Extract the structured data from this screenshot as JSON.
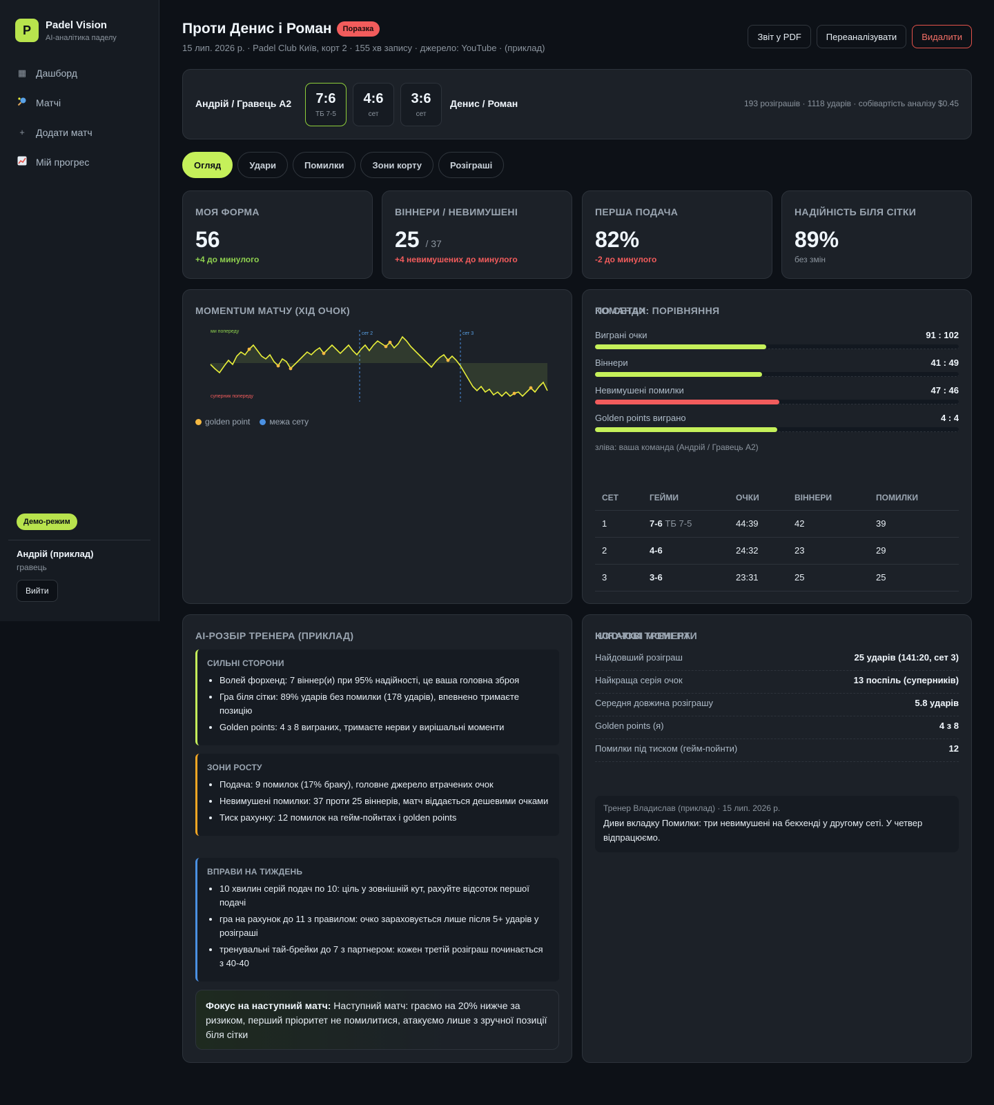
{
  "brand": {
    "name": "Padel Vision",
    "subtitle": "AI-аналітика паделу",
    "logo_letter": "P"
  },
  "nav": [
    {
      "label": "Дашборд",
      "icon": "dashboard-icon"
    },
    {
      "label": "Матчі",
      "icon": "racket-icon"
    },
    {
      "label": "Додати матч",
      "icon": "plus-icon"
    },
    {
      "label": "Мій прогрес",
      "icon": "chart-icon"
    }
  ],
  "sidebar": {
    "demo_badge": "Демо-режим",
    "user_name": "Андрій (приклад)",
    "user_role": "гравець",
    "logout": "Вийти"
  },
  "header": {
    "title": "Проти Денис і Роман",
    "result_badge": "Поразка",
    "subtitle": "15 лип. 2026 р. · Padel Club Київ, корт 2 · 155 хв запису · джерело: YouTube · (приклад)",
    "buttons": {
      "pdf": "Звіт у PDF",
      "reanalyze": "Переаналізувати",
      "delete": "Видалити"
    }
  },
  "score": {
    "team_left": "Андрій / Гравець A2",
    "team_right": "Денис / Роман",
    "sets": [
      {
        "score": "7:6",
        "caption": "ТБ 7-5",
        "won": true
      },
      {
        "score": "4:6",
        "caption": "сет",
        "won": false
      },
      {
        "score": "3:6",
        "caption": "сет",
        "won": false
      }
    ],
    "meta": "193 розіграшів · 1118 ударів · собівартість аналізу $0.45"
  },
  "tabs": [
    "Огляд",
    "Удари",
    "Помилки",
    "Зони корту",
    "Розіграші"
  ],
  "stats": [
    {
      "label": "МОЯ ФОРМА",
      "value": "56",
      "suffix": "",
      "delta": "+4 до минулого",
      "tone": "green"
    },
    {
      "label": "ВІННЕРИ / НЕВИМУШЕНІ",
      "value": "25",
      "suffix": "/ 37",
      "delta": "+4 невимушених до минулого",
      "tone": "red"
    },
    {
      "label": "ПЕРША ПОДАЧА",
      "value": "82%",
      "suffix": "",
      "delta": "-2 до минулого",
      "tone": "red"
    },
    {
      "label": "НАДІЙНІСТЬ БІЛЯ СІТКИ",
      "value": "89%",
      "suffix": "",
      "delta": "без змін",
      "tone": "muted"
    }
  ],
  "momentum": {
    "title": "MOMENTUM МАТЧУ (ХІД ОЧОК)",
    "label_ahead": "ми попереду",
    "label_behind": "суперник попереду",
    "set_markers": [
      "сет 2",
      "сет 3"
    ],
    "legend": {
      "golden": "golden point",
      "set_boundary": "межа сету"
    },
    "colors": {
      "line": "#e8ef3a",
      "golden": "#f5b942",
      "boundary": "#4a90e2"
    }
  },
  "compare": {
    "title": "КОМАНДИ: ПОРІВНЯННЯ",
    "rows": [
      {
        "label": "Виграні очки",
        "left": "91",
        "right": "102",
        "share": 0.471,
        "color": "green"
      },
      {
        "label": "Віннери",
        "left": "41",
        "right": "49",
        "share": 0.459,
        "color": "green"
      },
      {
        "label": "Невимушені помилки",
        "left": "47",
        "right": "46",
        "share": 0.507,
        "color": "red"
      },
      {
        "label": "Golden points виграно",
        "left": "4",
        "right": "4",
        "share": 0.5,
        "color": "green"
      }
    ],
    "note": "зліва: ваша команда (Андрій / Гравець A2)"
  },
  "sets_table": {
    "title": "ПО СЕТАХ",
    "headers": [
      "СЕТ",
      "ГЕЙМИ",
      "ОЧКИ",
      "ВІННЕРИ",
      "ПОМИЛКИ"
    ],
    "rows": [
      {
        "set": "1",
        "games": "7-6",
        "tb": "ТБ 7-5",
        "points": "44:39",
        "winners": "42",
        "errors": "39"
      },
      {
        "set": "2",
        "games": "4-6",
        "tb": "",
        "points": "24:32",
        "winners": "23",
        "errors": "29"
      },
      {
        "set": "3",
        "games": "3-6",
        "tb": "",
        "points": "23:31",
        "winners": "25",
        "errors": "25"
      }
    ]
  },
  "ai": {
    "title": "AI-РОЗБІР ТРЕНЕРА (ПРИКЛАД)",
    "strengths": {
      "title": "СИЛЬНІ СТОРОНИ",
      "items": [
        "Волей форхенд: 7 віннер(и) при 95% надійності, це ваша головна зброя",
        "Гра біля сітки: 89% ударів без помилки (178 ударів), впевнено тримаєте позицію",
        "Golden points: 4 з 8 виграних, тримаєте нерви у вирішальні моменти"
      ]
    },
    "growth": {
      "title": "ЗОНИ РОСТУ",
      "items": [
        "Подача: 9 помилок (17% браку), головне джерело втрачених очок",
        "Невимушені помилки: 37 проти 25 віннерів, матч віддається дешевими очками",
        "Тиск рахунку: 12 помилок на гейм-пойнтах і golden points"
      ]
    },
    "drills": {
      "title": "ВПРАВИ НА ТИЖДЕНЬ",
      "items": [
        "10 хвилин серій подач по 10: ціль у зовнішній кут, рахуйте відсоток першої подачі",
        "гра на рахунок до 11 з правилом: очко зараховується лише після 5+ ударів у розіграші",
        "тренувальні тай-брейки до 7 з партнером: кожен третій розіграш починається з 40-40"
      ]
    },
    "focus_label": "Фокус на наступний матч:",
    "focus_text": "Наступний матч: граємо на 20% нижче за ризиком, перший пріоритет не помилитися, атакуємо лише з зручної позиції біля сітки"
  },
  "moments": {
    "title": "КЛЮЧОВІ МОМЕНТИ",
    "rows": [
      {
        "label": "Найдовший розіграш",
        "value": "25 ударів (141:20, сет 3)"
      },
      {
        "label": "Найкраща серія очок",
        "value": "13 поспіль (суперників)"
      },
      {
        "label": "Середня довжина розіграшу",
        "value": "5.8 ударів"
      },
      {
        "label": "Golden points (я)",
        "value": "4 з 8"
      },
      {
        "label": "Помилки під тиском (гейм-пойнти)",
        "value": "12"
      }
    ],
    "notes_title": "НОТАТКИ ТРЕНЕРА",
    "note_meta": "Тренер Владислав (приклад) · 15 лип. 2026 р.",
    "note_text": "Диви вкладку Помилки: три невимушені на бекхенді у другому сеті. У четвер відпрацюємо."
  },
  "colors": {
    "accent": "#c5f05a",
    "danger": "#f25c5c",
    "bg": "#0d1117",
    "card": "#1c2128"
  }
}
